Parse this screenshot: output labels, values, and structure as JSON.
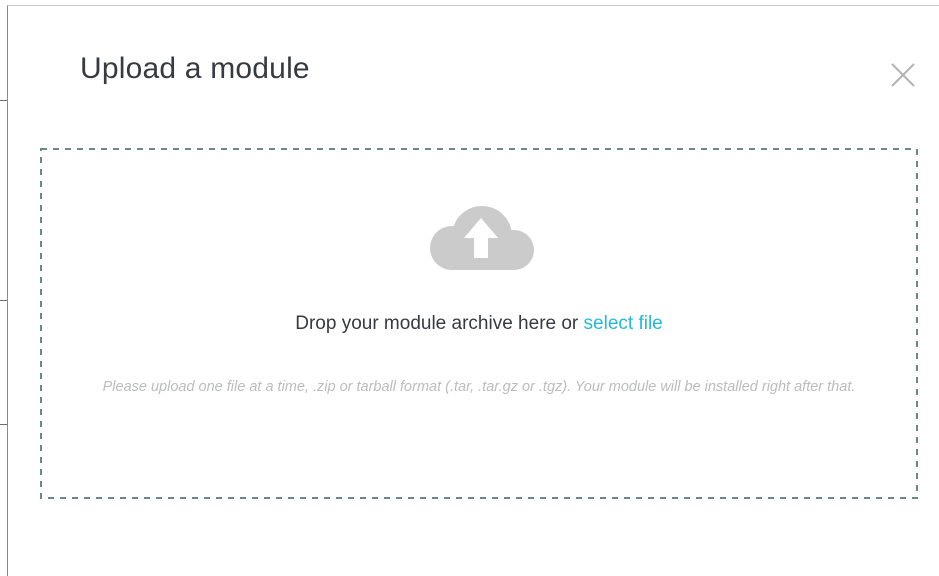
{
  "modal": {
    "title": "Upload a module",
    "close_icon": "close-icon"
  },
  "dropzone": {
    "icon": "cloud-upload-icon",
    "text_before": "Drop your module archive here or ",
    "select_link": "select file",
    "help_text": "Please upload one file at a time, .zip or tarball format (.tar, .tar.gz or .tgz). Your module will be installed right after that."
  },
  "colors": {
    "title": "#363a41",
    "link": "#25b9d7",
    "help_text": "#bbbcbd",
    "dashed_border": "#6c868e",
    "cloud_icon": "#cbcbcb"
  }
}
